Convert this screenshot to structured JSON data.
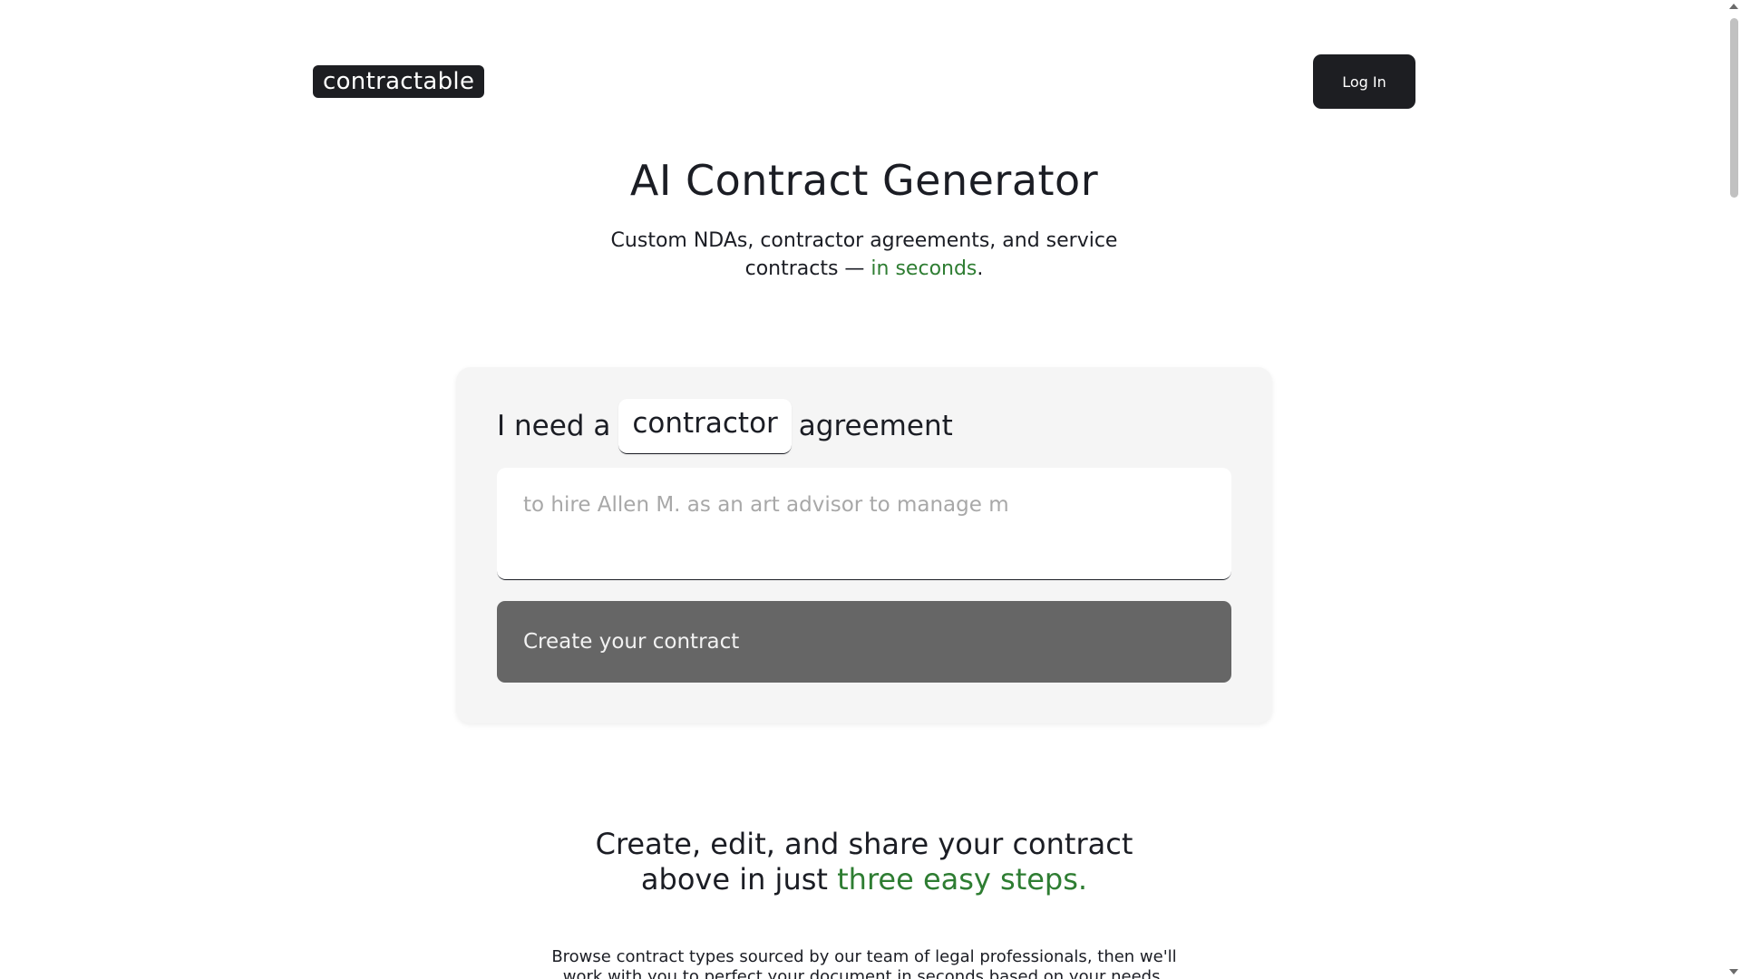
{
  "header": {
    "logo": "contractable",
    "login_label": "Log In"
  },
  "hero": {
    "title": "AI Contract Generator",
    "subtitle_main": "Custom NDAs, contractor agreements, and service contracts — ",
    "subtitle_accent": "in seconds",
    "subtitle_end": "."
  },
  "form": {
    "prefix": "I need a",
    "selected_type": "contractor",
    "suffix": "agreement",
    "description_placeholder": "to hire Allen M. as an art advisor to manage m",
    "description_value": "",
    "submit_label": "Create your contract"
  },
  "steps": {
    "heading_main": "Create, edit, and share your contract above in just ",
    "heading_accent": "three easy steps.",
    "body": "Browse contract types sourced by our team of legal professionals, then we'll work with you to perfect your document in seconds based on your needs."
  },
  "colors": {
    "accent": "#2e7d32",
    "dark": "#1d1e22",
    "card_bg": "#f5f5f5",
    "button_gray": "#666666"
  }
}
